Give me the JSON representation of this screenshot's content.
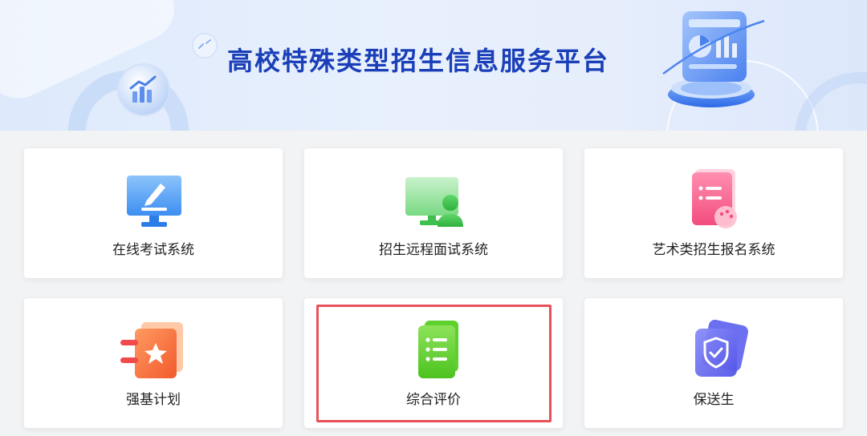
{
  "banner": {
    "title": "高校特殊类型招生信息服务平台"
  },
  "systems": [
    {
      "label": "在线考试系统",
      "icon": "monitor-pen-icon"
    },
    {
      "label": "招生远程面试系统",
      "icon": "video-interview-icon"
    },
    {
      "label": "艺术类招生报名系统",
      "icon": "palette-document-icon"
    },
    {
      "label": "强基计划",
      "icon": "star-notebook-icon"
    },
    {
      "label": "综合评价",
      "icon": "checklist-icon"
    },
    {
      "label": "保送生",
      "icon": "shield-check-icon"
    }
  ],
  "highlighted_item": "综合评价",
  "colors": {
    "banner_title": "#1a3fb8",
    "highlight": "#e8505a"
  }
}
